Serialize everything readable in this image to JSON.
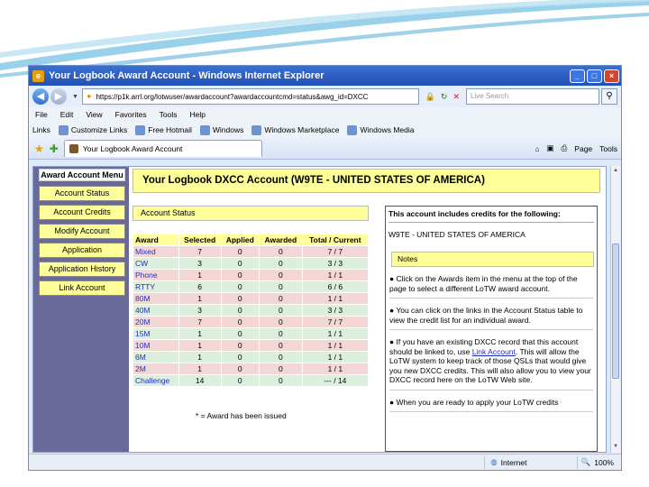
{
  "window": {
    "title": "Your Logbook Award Account - Windows Internet Explorer",
    "buttons": {
      "minimize": "_",
      "maximize": "□",
      "close": "×"
    }
  },
  "address_bar": {
    "url": "https://p1k.arrl.org/lotwuser/awardaccount?awardaccountcmd=status&awg_id=DXCC",
    "search_placeholder": "Live Search"
  },
  "menu": [
    "File",
    "Edit",
    "View",
    "Favorites",
    "Tools",
    "Help"
  ],
  "links_bar": {
    "label": "Links",
    "items": [
      "Customize Links",
      "Free Hotmail",
      "Windows",
      "Windows Marketplace",
      "Windows Media"
    ]
  },
  "tab": {
    "label": "Your Logbook Award Account"
  },
  "toolbar": {
    "page": "Page",
    "tools": "Tools"
  },
  "sidebar": {
    "title": "Award Account Menu",
    "items": [
      "Account Status",
      "Account Credits",
      "Modify Account",
      "Application",
      "Application History",
      "Link Account"
    ]
  },
  "main": {
    "header": "Your Logbook DXCC Account (W9TE - UNITED STATES OF AMERICA)",
    "account_status_header": "Account Status",
    "table": {
      "columns": [
        "Award",
        "Selected",
        "Applied",
        "Awarded",
        "Total / Current"
      ],
      "rows": [
        [
          "Mixed",
          "7",
          "0",
          "0",
          "7 / 7"
        ],
        [
          "CW",
          "3",
          "0",
          "0",
          "3 / 3"
        ],
        [
          "Phone",
          "1",
          "0",
          "0",
          "1 / 1"
        ],
        [
          "RTTY",
          "6",
          "0",
          "0",
          "6 / 6"
        ],
        [
          "80M",
          "1",
          "0",
          "0",
          "1 / 1"
        ],
        [
          "40M",
          "3",
          "0",
          "0",
          "3 / 3"
        ],
        [
          "20M",
          "7",
          "0",
          "0",
          "7 / 7"
        ],
        [
          "15M",
          "1",
          "0",
          "0",
          "1 / 1"
        ],
        [
          "10M",
          "1",
          "0",
          "0",
          "1 / 1"
        ],
        [
          "6M",
          "1",
          "0",
          "0",
          "1 / 1"
        ],
        [
          "2M",
          "1",
          "0",
          "0",
          "1 / 1"
        ],
        [
          "Challenge",
          "14",
          "0",
          "0",
          "--- / 14"
        ]
      ]
    },
    "footnote": "* = Award has been issued"
  },
  "right_pane": {
    "title": "This account includes credits for the following:",
    "callsign": "W9TE - UNITED STATES OF AMERICA",
    "notes_header": "Notes",
    "note1": "Click on the Awards item in the menu at the top of the page to select a different LoTW award account.",
    "note2": "You can click on the links in the Account Status table to view the credit list for an individual award.",
    "note3_before": "If you have an existing DXCC record that this account should be linked to, use ",
    "note3_link": "Link Account",
    "note3_after": ". This will allow the LoTW system to keep track of those QSLs that would give you new DXCC credits. This will also allow you to view your DXCC record here on the LoTW Web site.",
    "note4": "When you are ready to apply your LoTW credits"
  },
  "statusbar": {
    "zone": "Internet",
    "zoom": "100%"
  },
  "colors": {
    "yellow": "#ffff99",
    "sidebar": "#6a6a9a",
    "row_green": "#dcefdc",
    "row_pink": "#f3d7d7",
    "link": "#1f2fbf",
    "titlebar": "#2350b6"
  }
}
